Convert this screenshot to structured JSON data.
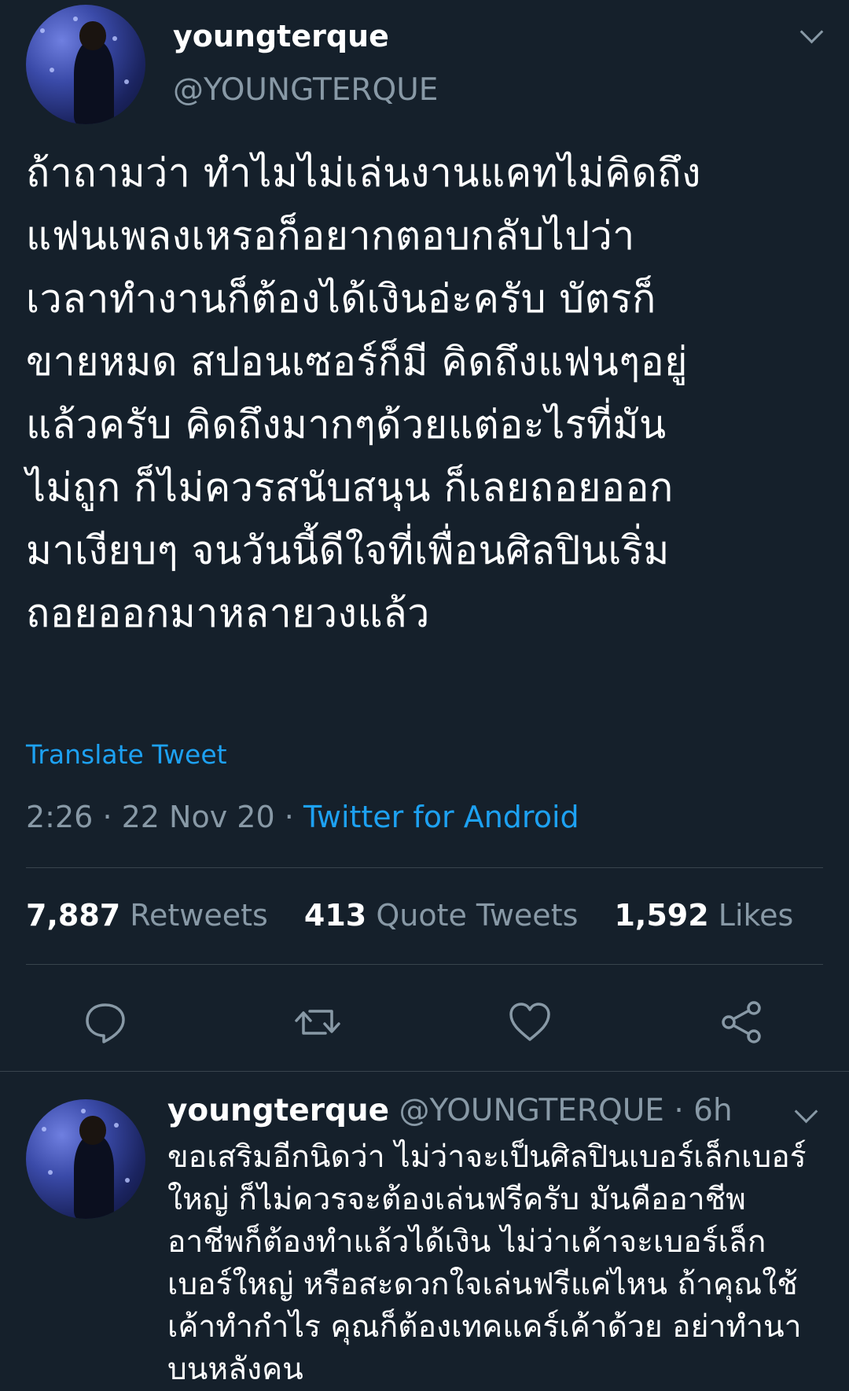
{
  "main_tweet": {
    "display_name": "youngterque",
    "handle": "@YOUNGTERQUE",
    "text": "ถ้าถามว่า ทำไมไม่เล่นงานแคทไม่คิดถึง\nแฟนเพลงเหรอก็อยากตอบกลับไปว่า\nเวลาทำงานก็ต้องได้เงินอ่ะครับ บัตรก็\nขายหมด สปอนเซอร์ก็มี คิดถึงแฟนๆอยู่\nแล้วครับ คิดถึงมากๆด้วยแต่อะไรที่มัน\nไม่ถูก ก็ไม่ควรสนับสนุน ก็เลยถอยออก\nมาเงียบๆ จนวันนี้ดีใจที่เพื่อนศิลปินเริ่ม\nถอยออกมาหลายวงแล้ว",
    "translate_label": "Translate Tweet",
    "time": "2:26",
    "date": "22 Nov 20",
    "separator": "·",
    "source": "Twitter for Android",
    "stats": {
      "retweets_count": "7,887",
      "retweets_label": "Retweets",
      "quotes_count": "413",
      "quotes_label": "Quote Tweets",
      "likes_count": "1,592",
      "likes_label": "Likes"
    }
  },
  "reply_tweet": {
    "display_name": "youngterque",
    "handle": "@YOUNGTERQUE",
    "separator": "·",
    "age": "6h",
    "text": "ขอเสริมอีกนิดว่า ไม่ว่าจะเป็นศิลปินเบอร์เล็กเบอร์\nใหญ่ ก็ไม่ควรจะต้องเล่นฟรีครับ มันคืออาชีพ\nอาชีพก็ต้องทำแล้วได้เงิน ไม่ว่าเค้าจะเบอร์เล็ก\nเบอร์ใหญ่ หรือสะดวกใจเล่นฟรีแค่ไหน ถ้าคุณใช้\nเค้าทำกำไร คุณก็ต้องเทคแคร์เค้าด้วย อย่าทำนา\nบนหลังคน"
  },
  "icons": [
    "avatar",
    "chevron-down-icon",
    "reply-icon",
    "retweet-icon",
    "like-icon",
    "share-icon"
  ],
  "colors": {
    "background": "#15202b",
    "text": "#ffffff",
    "secondary": "#8899a6",
    "accent": "#1da1f2",
    "divider": "#38444d"
  }
}
